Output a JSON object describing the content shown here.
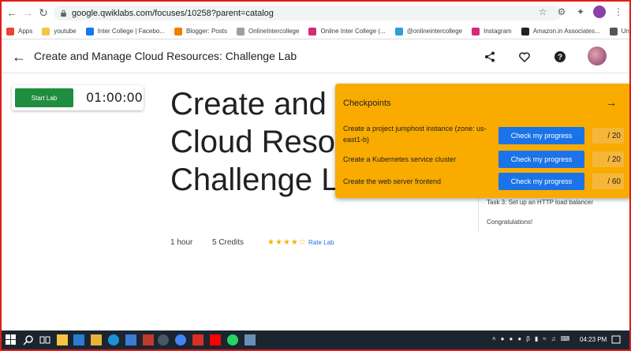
{
  "browser": {
    "url": "google.qwiklabs.com/focuses/10258?parent=catalog",
    "bookmarks": [
      {
        "label": "Apps",
        "icon": "apps-grid-icon",
        "color": "#ea4335"
      },
      {
        "label": "youtube",
        "icon": "folder-icon",
        "color": "#f4c542"
      },
      {
        "label": "Inter College | Facebo...",
        "icon": "facebook-icon",
        "color": "#1877f2"
      },
      {
        "label": "Blogger: Posts",
        "icon": "blogger-icon",
        "color": "#f57d00"
      },
      {
        "label": "OnlineIntercollege",
        "icon": "page-icon",
        "color": "#9aa0a6"
      },
      {
        "label": "Online Inter College (...",
        "icon": "instagram-icon",
        "color": "#d62976"
      },
      {
        "label": "@onlineintercollege",
        "icon": "telegram-icon",
        "color": "#2aa1da"
      },
      {
        "label": "Instagram",
        "icon": "instagram-icon",
        "color": "#d62976"
      },
      {
        "label": "Amazon.in Associates...",
        "icon": "amazon-icon",
        "color": "#222222"
      },
      {
        "label": "Unity - Manual: Unity...",
        "icon": "unity-icon",
        "color": "#555555"
      }
    ]
  },
  "header": {
    "title": "Create and Manage Cloud Resources: Challenge Lab"
  },
  "lab": {
    "start_label": "Start Lab",
    "timer": "01:00:00",
    "big_title": "Create and Manage Cloud Resources: Challenge Lab",
    "duration": "1 hour",
    "credits": "5 Credits",
    "rating_stars": 4,
    "rating_max": 5,
    "rate_label": "Rate Lab"
  },
  "tasks_side": {
    "task3": "Task 3: Set up an HTTP load balancer",
    "congrats": "Congratulations!"
  },
  "checkpoints": {
    "title": "Checkpoints",
    "items": [
      {
        "text": "Create a project jumphost instance (zone: us-east1-b)",
        "button": "Check my progress",
        "score": "/ 20"
      },
      {
        "text": "Create a Kubernetes service cluster",
        "button": "Check my progress",
        "score": "/ 20"
      },
      {
        "text": "Create the web server frontend",
        "button": "Check my progress",
        "score": "/ 60"
      }
    ]
  },
  "taskbar": {
    "time": "04:23 PM"
  },
  "colors": {
    "accent": "#1a73e8",
    "checkpoint_bg": "#f9ab00",
    "start_green": "#1e8e3e",
    "frame_red": "#e01b1b"
  }
}
